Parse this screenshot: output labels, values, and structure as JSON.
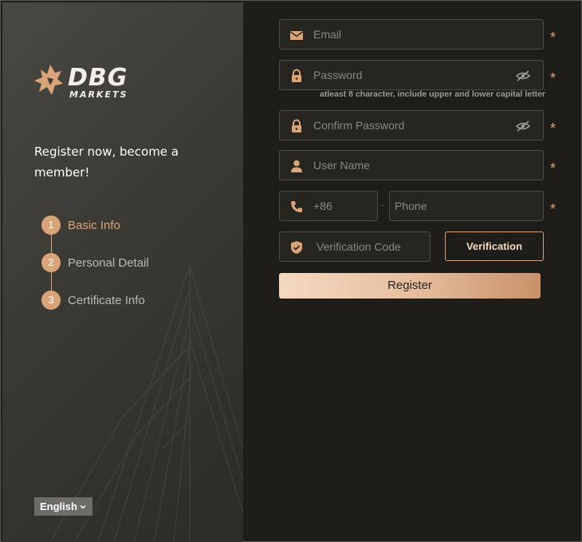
{
  "brand": {
    "name": "DBG",
    "subtitle": "MARKETS"
  },
  "sidebar": {
    "tagline": "Register now, become a member!",
    "steps": [
      {
        "num": "1",
        "label": "Basic Info",
        "active": true
      },
      {
        "num": "2",
        "label": "Personal Detail",
        "active": false
      },
      {
        "num": "3",
        "label": "Certificate Info",
        "active": false
      }
    ],
    "language": "English"
  },
  "form": {
    "email": {
      "placeholder": "Email"
    },
    "password": {
      "placeholder": "Password",
      "hint": "atleast 8 character, include upper and lower capital letter"
    },
    "confirm_password": {
      "placeholder": "Confirm Password"
    },
    "username": {
      "placeholder": "User Name"
    },
    "phone": {
      "country_code": "+86",
      "separator": "-",
      "placeholder": "Phone"
    },
    "verification": {
      "placeholder": "Verification Code",
      "button": "Verification"
    },
    "required_mark": "*",
    "register_button": "Register"
  },
  "colors": {
    "accent": "#d9a47a",
    "background": "#1f1d1a",
    "input_bg": "#27251f",
    "input_border": "#4f4c47"
  }
}
